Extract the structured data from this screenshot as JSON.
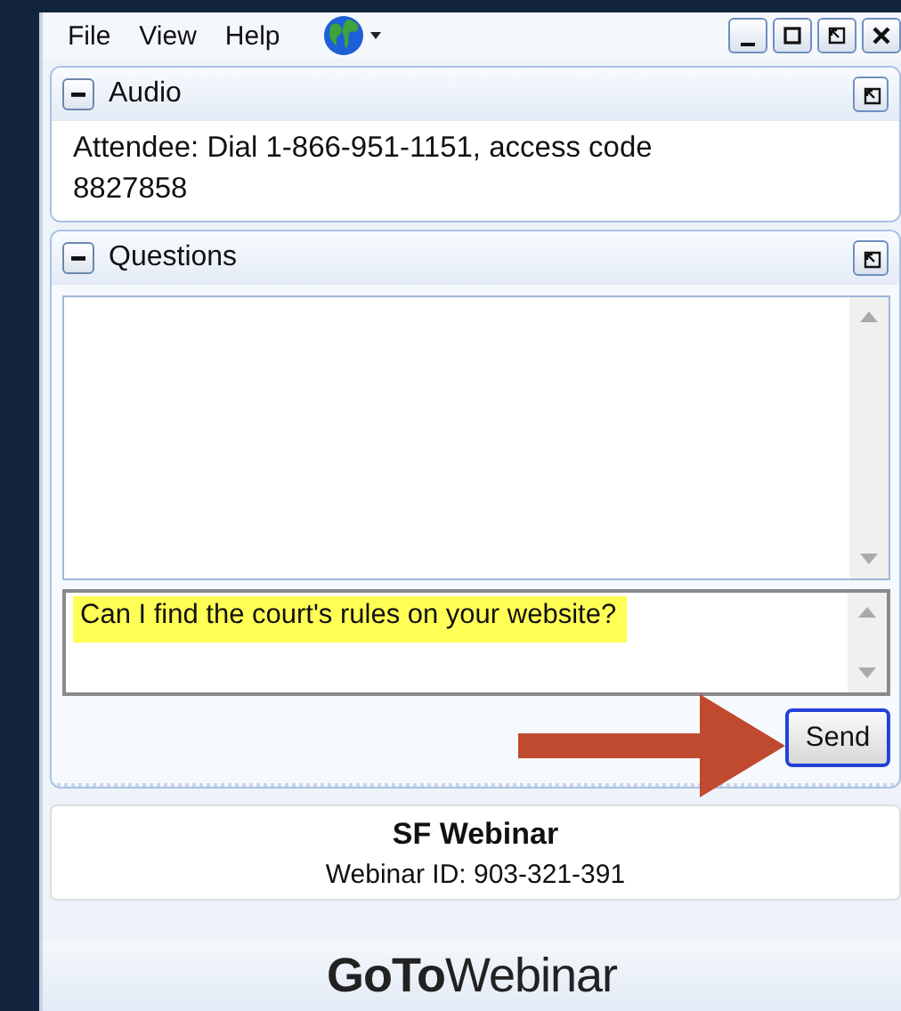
{
  "menu": [
    "File",
    "View",
    "Help"
  ],
  "window_buttons": [
    {
      "kind": "minimize"
    },
    {
      "kind": "maximize"
    },
    {
      "kind": "restore"
    },
    {
      "kind": "close"
    }
  ],
  "audio": {
    "title": "Audio",
    "expanded": true,
    "text": "Attendee: Dial 1-866-951-1151, access code 8827858"
  },
  "questions": {
    "title": "Questions",
    "expanded": true,
    "input": {
      "value": "Can I find the court's rules on your website?",
      "highlighted": true
    },
    "send": "Send"
  },
  "webinar": {
    "name": "SF Webinar",
    "id": "Webinar ID: 903-321-391"
  },
  "logo": "**GoTo**Webinar"
}
